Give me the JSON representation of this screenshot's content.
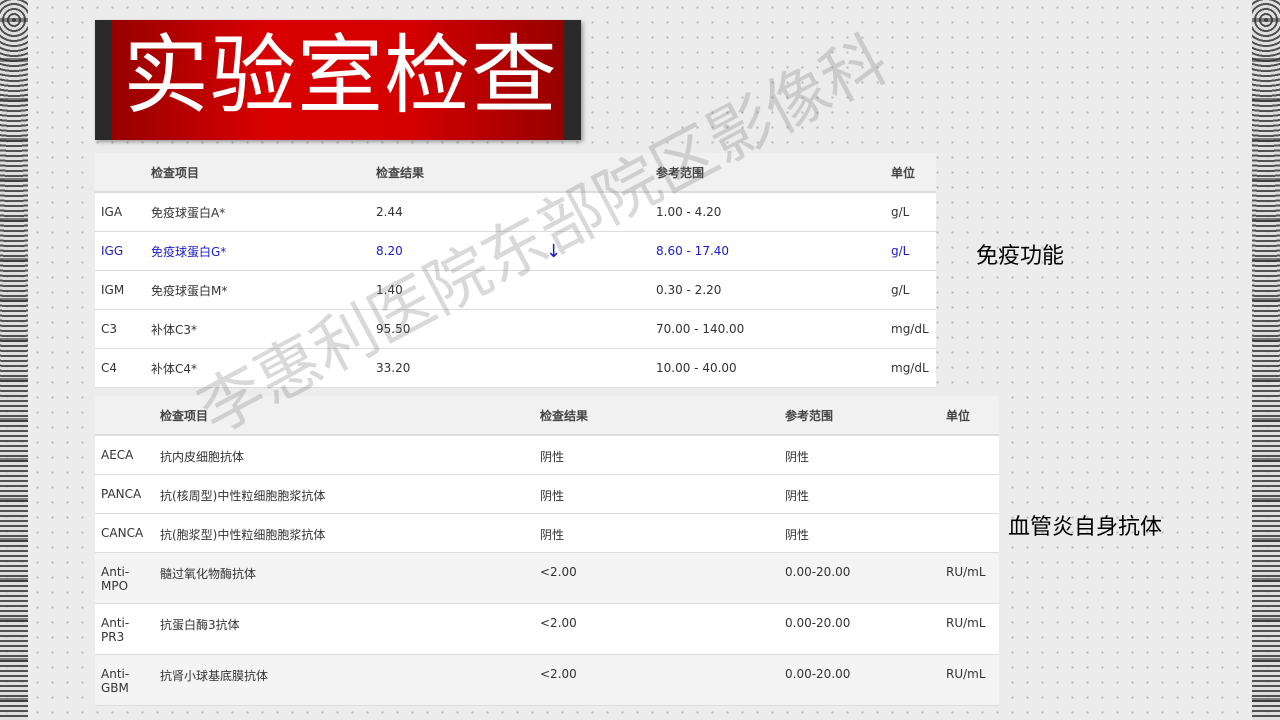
{
  "title": "实验室检查",
  "watermark": "李惠利医院东部院区影像科",
  "table1": {
    "headers": [
      "",
      "检查项目",
      "检查结果",
      "",
      "参考范围",
      "单位"
    ],
    "rows": [
      {
        "code": "IGA",
        "name": "免疫球蛋白A*",
        "result": "2.44",
        "flag": "",
        "range": "1.00 - 4.20",
        "unit": "g/L"
      },
      {
        "code": "IGG",
        "name": "免疫球蛋白G*",
        "result": "8.20",
        "flag": "↓",
        "range": "8.60 - 17.40",
        "unit": "g/L"
      },
      {
        "code": "IGM",
        "name": "免疫球蛋白M*",
        "result": "1.40",
        "flag": "",
        "range": "0.30 - 2.20",
        "unit": "g/L"
      },
      {
        "code": "C3",
        "name": "补体C3*",
        "result": "95.50",
        "flag": "",
        "range": "70.00 - 140.00",
        "unit": "mg/dL"
      },
      {
        "code": "C4",
        "name": "补体C4*",
        "result": "33.20",
        "flag": "",
        "range": "10.00 - 40.00",
        "unit": "mg/dL"
      }
    ]
  },
  "label_immune": "免疫功能",
  "table2": {
    "headers": [
      "",
      "检查项目",
      "检查结果",
      "参考范围",
      "单位"
    ],
    "rows": [
      {
        "code": "AECA",
        "name": "抗内皮细胞抗体",
        "result": "阴性",
        "range": "阴性",
        "unit": ""
      },
      {
        "code": "PANCA",
        "name": "抗(核周型)中性粒细胞胞浆抗体",
        "result": "阴性",
        "range": "阴性",
        "unit": ""
      },
      {
        "code": "CANCA",
        "name": "抗(胞浆型)中性粒细胞胞浆抗体",
        "result": "阴性",
        "range": "阴性",
        "unit": ""
      },
      {
        "code": "Anti-MPO",
        "name": "髓过氧化物酶抗体",
        "result": "<2.00",
        "range": "0.00-20.00",
        "unit": "RU/mL"
      },
      {
        "code": "Anti-PR3",
        "name": "抗蛋白酶3抗体",
        "result": "<2.00",
        "range": "0.00-20.00",
        "unit": "RU/mL"
      },
      {
        "code": "Anti-GBM",
        "name": "抗肾小球基底膜抗体",
        "result": "<2.00",
        "range": "0.00-20.00",
        "unit": "RU/mL"
      }
    ]
  },
  "label_vasc": "血管炎自身抗体"
}
